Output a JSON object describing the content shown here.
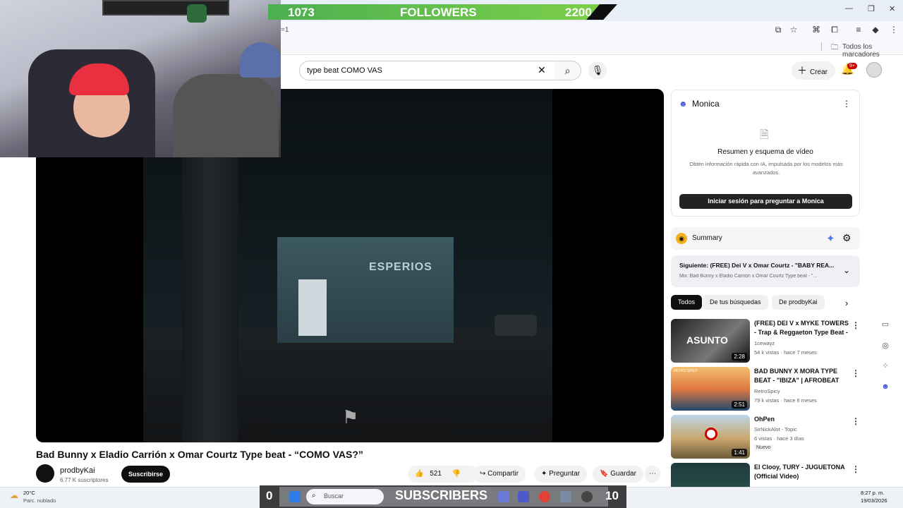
{
  "overlay": {
    "followers_current": "1073",
    "followers_label": "FOLLOWERS",
    "followers_goal": "2200",
    "subscribers_current": "0",
    "subscribers_label": "SUBSCRIBERS",
    "subscribers_goal": "10"
  },
  "browser": {
    "address_fragment": "=1",
    "bookmarks_label": "Todos los marcadores"
  },
  "header": {
    "search_value": "type beat COMO VAS",
    "create_label": "Crear",
    "notifications_badge": "9+"
  },
  "video": {
    "title": "Bad Bunny x Eladio Carrión x Omar Courtz Type beat - “COMO VAS?”",
    "channel": "prodbyKai",
    "subscribers": "6.77 K suscriptores",
    "subscribe_label": "Suscribirse",
    "likes": "521",
    "share_label": "Compartir",
    "ask_label": "Preguntar",
    "save_label": "Guardar",
    "sign_text": "ESPERIOS"
  },
  "monica": {
    "title": "Monica",
    "heading": "Resumen y esquema de vídeo",
    "description": "Obtén información rápida con IA, impulsada por los modelos más avanzados.",
    "button": "Iniciar sesión para preguntar a Monica"
  },
  "summary": {
    "label": "Summary"
  },
  "next_up": {
    "title": "Siguiente: (FREE) Dei V x Omar Courtz - \"BABY REA...",
    "subtitle": "Mix: Bad Bunny x Eladio Carrión x Omar Courtz Type beat - \"..."
  },
  "chips": [
    "Todos",
    "De tus búsquedas",
    "De prodbyKai"
  ],
  "recommendations": [
    {
      "title": "(FREE) DEI V x MYKE TOWERS - Trap & Reggaeton Type Beat - ...",
      "channel": "1cewayz",
      "meta": "54 k vistas · hace 7 meses",
      "duration": "2:28",
      "thumb_text": "ASUNTO",
      "badge": ""
    },
    {
      "title": "BAD BUNNY X MORA TYPE BEAT - \"IBIZA\" | AFROBEAT",
      "channel": "RetroSpicy",
      "meta": "79 k vistas · hace 6 meses",
      "duration": "2:51",
      "thumb_text": "RETRO SPICY",
      "badge": ""
    },
    {
      "title": "OhPen",
      "channel": "SirNickAlot - Topic",
      "meta": "6 vistas · hace 3 días",
      "duration": "1:41",
      "thumb_text": "",
      "badge": "Nuevo"
    },
    {
      "title": "El Clooy, TURY - JUGUETONA (Official Video)",
      "channel": "",
      "meta": "",
      "duration": "",
      "thumb_text": "",
      "badge": ""
    }
  ],
  "taskbar": {
    "weather_temp": "20°C",
    "weather_desc": "Parc. nublado",
    "search_placeholder": "Buscar",
    "time": "8:27 p. m.",
    "date": "19/03/2026"
  },
  "colors": {
    "accent": "#ff0000",
    "followers_fill": "#5cbf4a",
    "subscribe": "#0f0f0f"
  }
}
